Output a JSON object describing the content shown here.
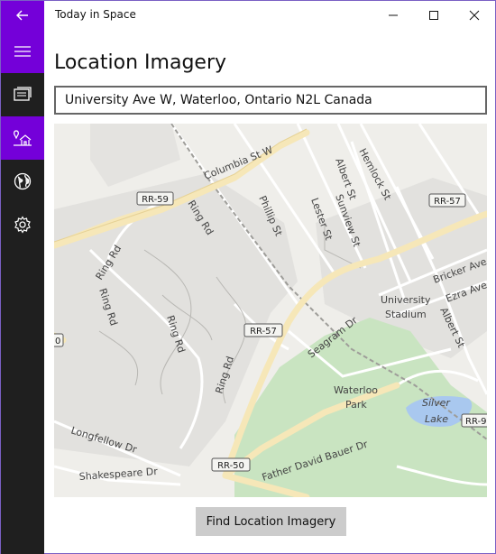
{
  "window": {
    "title": "Today in Space"
  },
  "page": {
    "title": "Location Imagery"
  },
  "search": {
    "value": "University Ave W, Waterloo, Ontario N2L Canada"
  },
  "find_button": {
    "label": "Find Location Imagery"
  },
  "nav": [
    {
      "icon": "hamburger-menu-icon"
    },
    {
      "icon": "gallery-icon"
    },
    {
      "icon": "home-location-icon",
      "active": true
    },
    {
      "icon": "globe-icon"
    },
    {
      "icon": "gear-icon"
    }
  ],
  "colors": {
    "accent": "#7400d9",
    "sidebar": "#1f1f1f",
    "park": "#c9e4c1",
    "water": "#a9c8ef"
  },
  "map": {
    "streets": {
      "columbia": "Columbia St W",
      "philip": "Phillip St",
      "lester": "Lester St",
      "albert_top": "Albert St",
      "sunview": "Sunview St",
      "hemlock": "Hemlock St",
      "ring_rd_1": "Ring Rd",
      "ring_rd_2": "Ring Rd",
      "ring_rd_3": "Ring Rd",
      "ring_rd_4": "Ring Rd",
      "seagram": "Seagram Dr",
      "albert_right": "Albert St",
      "bricker": "Bricker Ave",
      "ezra": "Ezra Ave",
      "longfellow": "Longfellow Dr",
      "shakespeare": "Shakespeare Dr",
      "father_david": "Father David Bauer Dr"
    },
    "shields": {
      "rr59": "RR-59",
      "rr57_top": "RR-57",
      "rr57_mid": "RR-57",
      "rr50": "RR-50",
      "rr9_partial": "RR-9",
      "r50_partial": "0"
    },
    "places": {
      "stadium_line1": "University",
      "stadium_line2": "Stadium",
      "park_line1": "Waterloo",
      "park_line2": "Park",
      "lake_line1": "Silver",
      "lake_line2": "Lake"
    }
  }
}
